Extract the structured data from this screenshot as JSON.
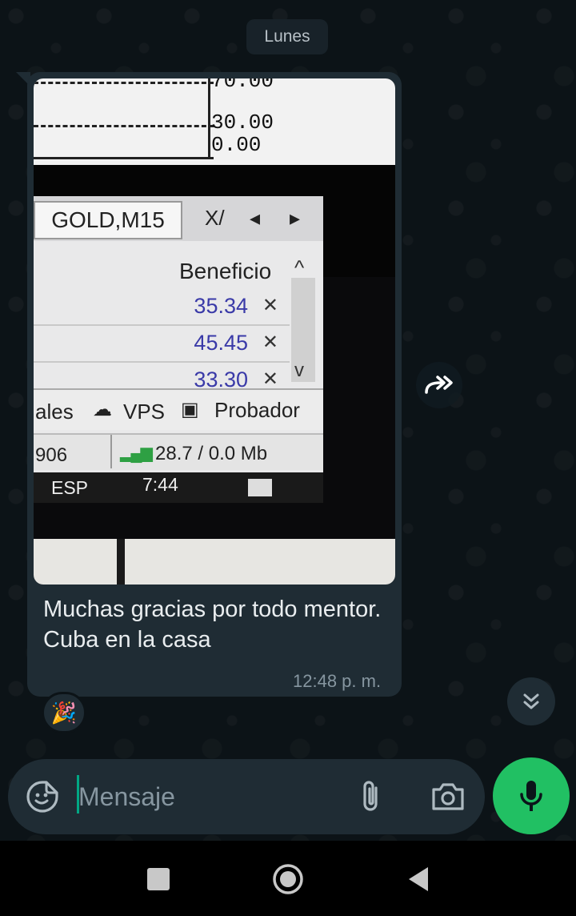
{
  "date_chip": "Lunes",
  "message": {
    "photo": {
      "ticks": [
        "70.00",
        "30.00",
        "0.00"
      ],
      "tab_label": "GOLD,M15",
      "tab_extra": "X/",
      "column_header": "Beneficio",
      "rows": [
        {
          "value": "35.34"
        },
        {
          "value": "45.45"
        },
        {
          "value": "33.30"
        }
      ],
      "status_left": "ales",
      "status_vps": "VPS",
      "status_probador": "Probador",
      "net_left": "906",
      "net_rate": "28.7 / 0.0 Mb",
      "taskbar_lang": "ESP",
      "taskbar_time": "7:44"
    },
    "caption": "Muchas gracias por todo mentor. Cuba en la casa",
    "time": "12:48 p. m.",
    "reaction": "🎉"
  },
  "composer": {
    "placeholder": "Mensaje"
  },
  "icons": {
    "forward": "forward-icon",
    "scroll_down": "double-chevron-down-icon",
    "emoji": "sticker-icon",
    "attach": "paperclip-icon",
    "camera": "camera-icon",
    "mic": "microphone-icon"
  },
  "colors": {
    "background": "#0b141a",
    "bubble": "#1f2c34",
    "accent": "#21c063",
    "caret": "#00a884",
    "secondary_text": "#8696a0"
  }
}
